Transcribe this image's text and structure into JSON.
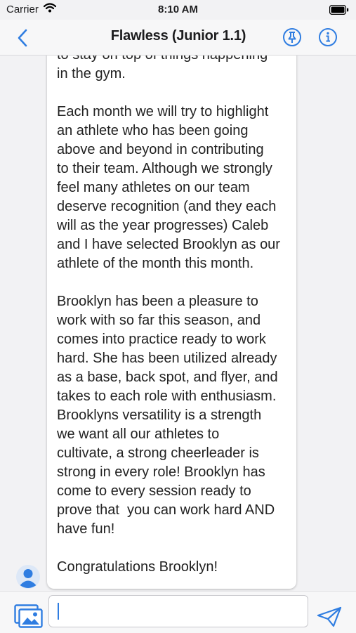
{
  "status_bar": {
    "carrier": "Carrier",
    "time": "8:10 AM"
  },
  "nav": {
    "title": "Flawless (Junior 1.1)"
  },
  "message": {
    "text": "to stay on top of things happening\nin the gym.\n\nEach month we will try to highlight\nan athlete who has been going\nabove and beyond in contributing\nto their team. Although we strongly\nfeel many athletes on our team\ndeserve recognition (and they each\nwill as the year progresses) Caleb\nand I have selected Brooklyn as our\nathlete of the month this month.\n\nBrooklyn has been a pleasure to\nwork with so far this season, and\ncomes into practice ready to work\nhard. She has been utilized already\nas a base, back spot, and flyer, and\ntakes to each role with enthusiasm.\nBrooklyns versatility is a strength\nwe want all our athletes to\ncultivate, a strong cheerleader is\nstrong in every role! Brooklyn has\ncome to every session ready to\nprove that  you can work hard AND\nhave fun!\n\nCongratulations Brooklyn!"
  },
  "composer": {
    "value": "",
    "placeholder": ""
  },
  "colors": {
    "accent": "#2f7de1",
    "background": "#f2f2f4",
    "bubble": "#ffffff"
  },
  "icons": [
    "wifi-icon",
    "battery-icon",
    "back-chevron-icon",
    "pin-icon",
    "info-icon",
    "avatar-icon",
    "photo-library-icon",
    "send-icon"
  ]
}
